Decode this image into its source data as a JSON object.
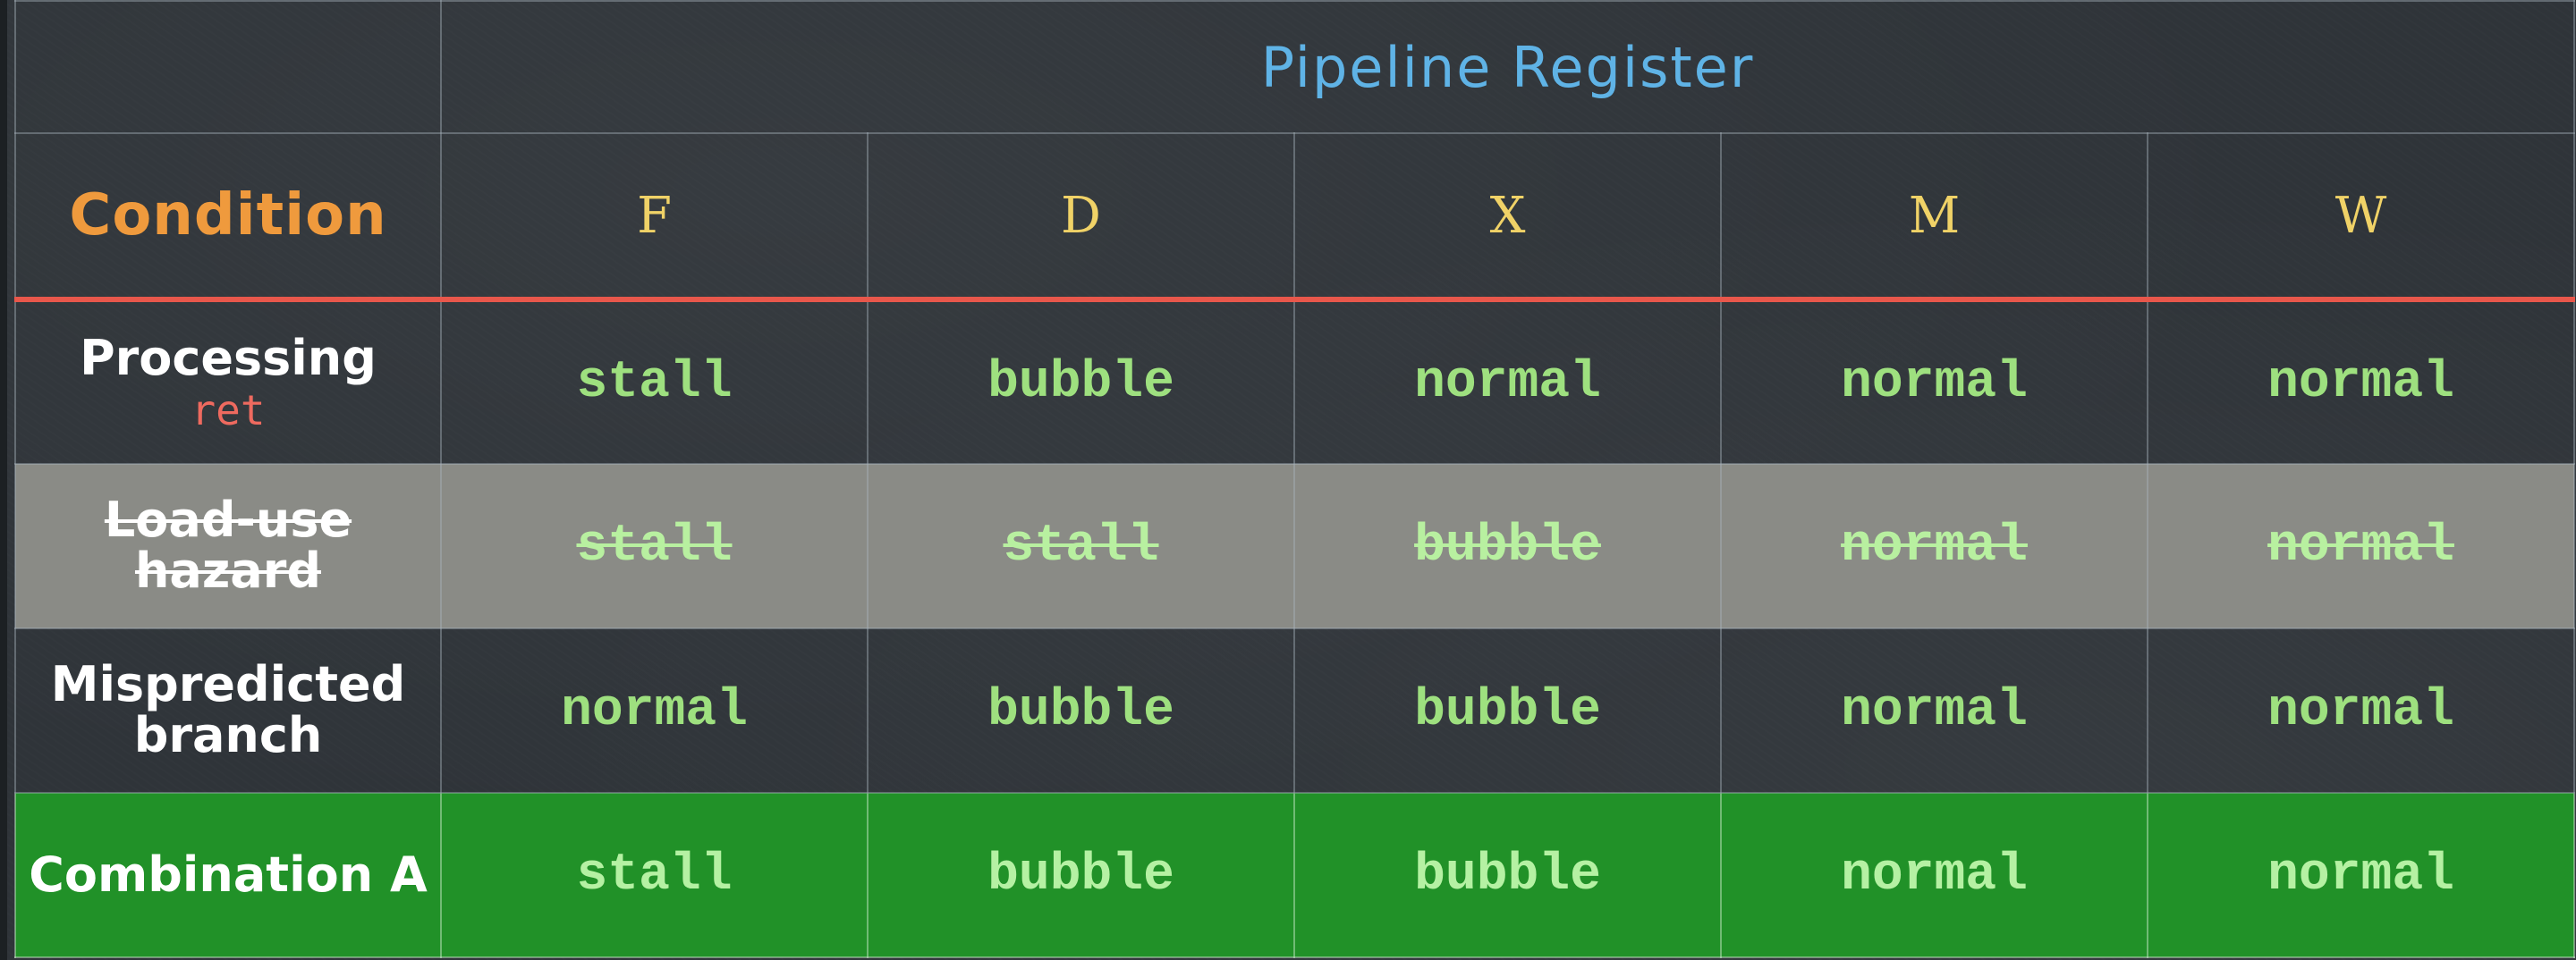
{
  "table": {
    "title": "Pipeline Register",
    "condition_header": "Condition",
    "stages": [
      "F",
      "D",
      "X",
      "M",
      "W"
    ],
    "rows": [
      {
        "condition": "Processing",
        "condition_sub": "ret",
        "values": [
          "stall",
          "bubble",
          "normal",
          "normal",
          "normal"
        ]
      },
      {
        "condition": "Load-use hazard",
        "struck_out": true,
        "values": [
          "stall",
          "stall",
          "bubble",
          "normal",
          "normal"
        ]
      },
      {
        "condition": "Mispredicted branch",
        "values": [
          "normal",
          "bubble",
          "bubble",
          "normal",
          "normal"
        ]
      },
      {
        "condition": "Combination A",
        "highlighted": true,
        "values": [
          "stall",
          "bubble",
          "bubble",
          "normal",
          "normal"
        ]
      }
    ]
  },
  "colors": {
    "title": "#5fb3e6",
    "condition_header": "#ef9a3d",
    "stage_header": "#f0d267",
    "header_rule": "#e8574b",
    "cell_value": "#9ee07f",
    "struck_row_bg": "#8a8b86",
    "highlight_row_bg": "#219128",
    "ret_label": "#ee6a5f"
  }
}
